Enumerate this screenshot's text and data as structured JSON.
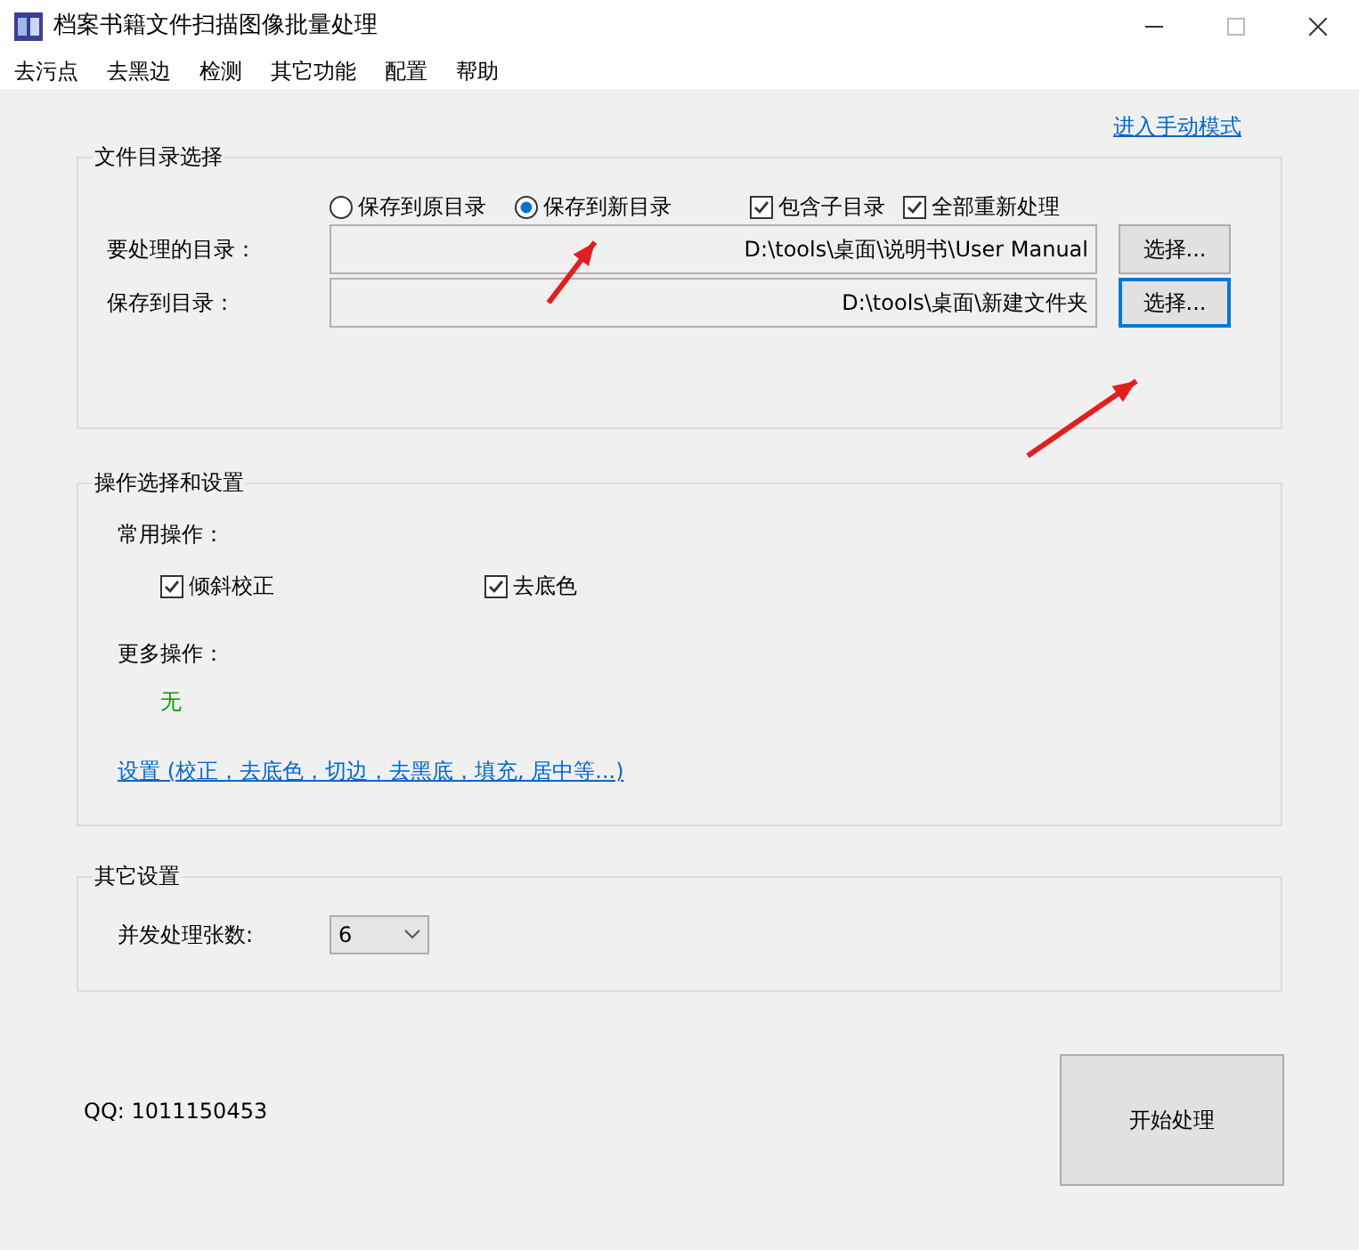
{
  "window": {
    "title": "档案书籍文件扫描图像批量处理"
  },
  "menu": [
    {
      "label": "去污点"
    },
    {
      "label": "去黑边"
    },
    {
      "label": "检测"
    },
    {
      "label": "其它功能"
    },
    {
      "label": "配置"
    },
    {
      "label": "帮助"
    }
  ],
  "manual_mode_link": "进入手动模式",
  "directory_group": {
    "title": "文件目录选择",
    "radios": [
      {
        "label": "保存到原目录",
        "selected": false
      },
      {
        "label": "保存到新目录",
        "selected": true
      }
    ],
    "checkboxes": [
      {
        "label": "包含子目录",
        "checked": true
      },
      {
        "label": "全部重新处理",
        "checked": true
      }
    ],
    "rows": [
      {
        "label": "要处理的目录：",
        "value": "D:\\tools\\桌面\\说明书\\User Manual",
        "button": "选择...",
        "focused": false
      },
      {
        "label": "保存到目录：",
        "value": "D:\\tools\\桌面\\新建文件夹",
        "button": "选择...",
        "focused": true
      }
    ]
  },
  "operations_group": {
    "title": "操作选择和设置",
    "common_label": "常用操作：",
    "checkboxes": [
      {
        "label": "倾斜校正",
        "checked": true
      },
      {
        "label": "去底色",
        "checked": true
      }
    ],
    "more_label": "更多操作：",
    "more_value": "无",
    "settings_link": "设置 (校正，去底色，切边，去黑底，填充, 居中等...)"
  },
  "other_group": {
    "title": "其它设置",
    "concurrency_label": "并发处理张数:",
    "concurrency_value": "6"
  },
  "qq": "QQ: 1011150453",
  "start_button": "开始处理"
}
